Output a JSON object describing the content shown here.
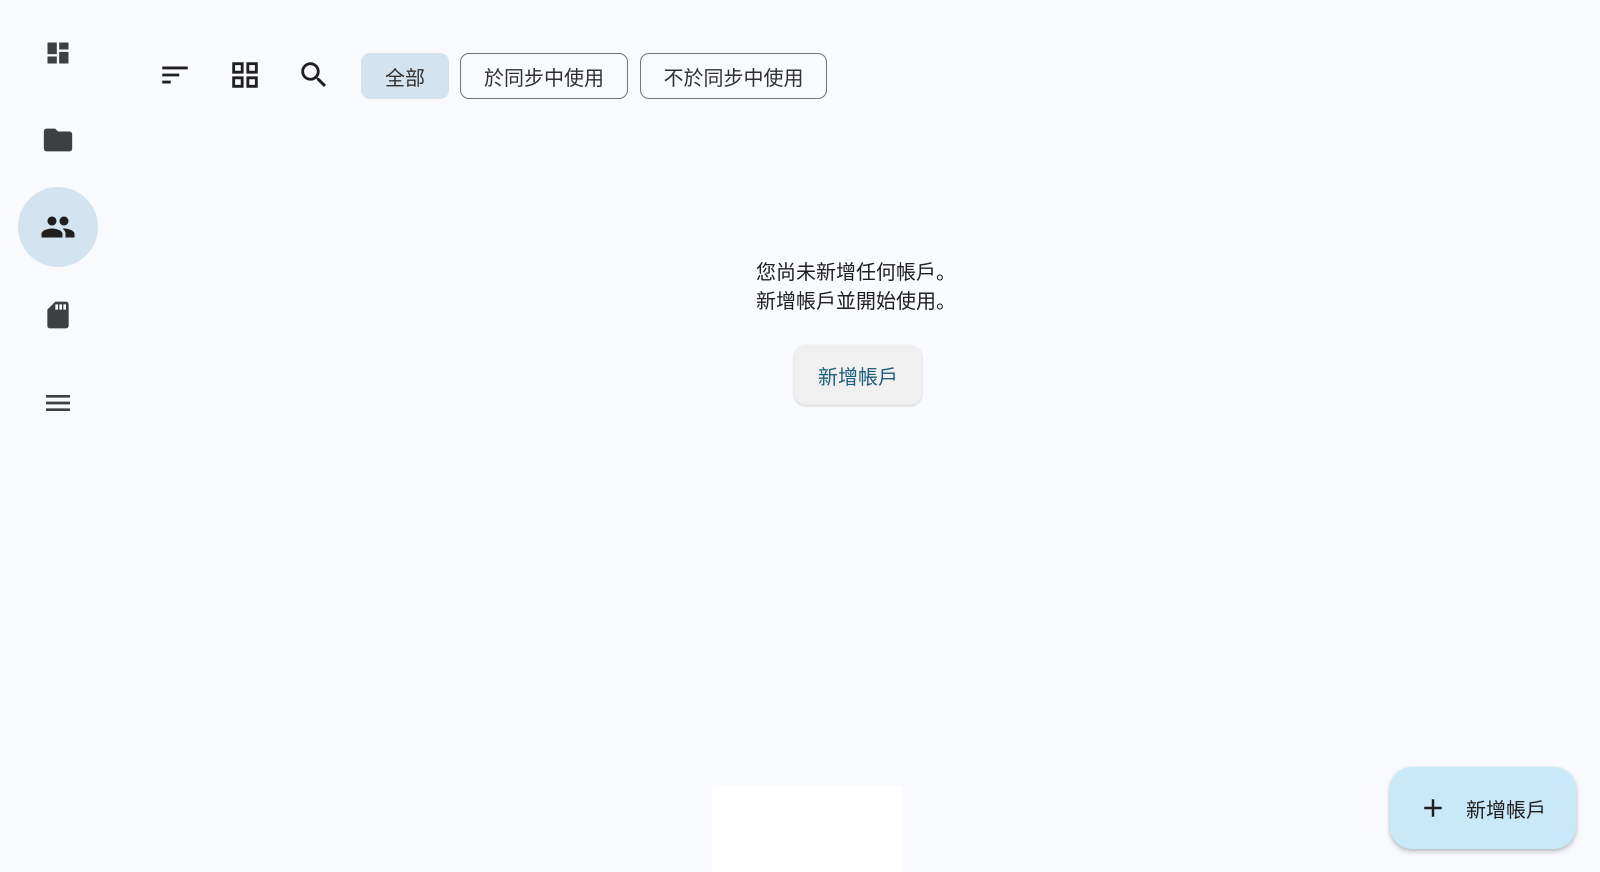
{
  "nav_rail": {
    "items": [
      {
        "icon": "dashboard-icon"
      },
      {
        "icon": "folder-icon"
      },
      {
        "icon": "people-icon",
        "active": true
      },
      {
        "icon": "sd-card-icon"
      },
      {
        "icon": "menu-icon"
      }
    ]
  },
  "toolbar": {
    "icons": [
      "sort-icon",
      "grid-view-icon",
      "search-icon"
    ],
    "filters": [
      {
        "label": "全部",
        "selected": true
      },
      {
        "label": "於同步中使用",
        "selected": false
      },
      {
        "label": "不於同步中使用",
        "selected": false
      }
    ]
  },
  "empty_state": {
    "line1": "您尚未新增任何帳戶。",
    "line2": "新增帳戶並開始使用。",
    "button_label": "新增帳戶"
  },
  "fab": {
    "icon": "add-icon",
    "label": "新增帳戶"
  },
  "colors": {
    "background": "#f8fafd",
    "accent_container": "#d3e3ef",
    "fab_container": "#c9e8f8",
    "link_text": "#1d5f7a",
    "icon": "#3c4043"
  }
}
